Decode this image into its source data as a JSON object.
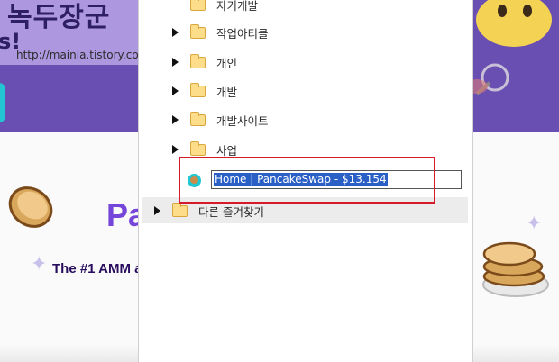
{
  "watermark": {
    "title": "녹두장군",
    "url": "http://mainia.tistory.com",
    "fragment": "s!"
  },
  "background": {
    "heading_fragment": "Pa",
    "tagline_fragment": "The #1 AMM a"
  },
  "bookmarks": {
    "items": [
      {
        "label": "자기개발"
      },
      {
        "label": "작업아티클"
      },
      {
        "label": "개인"
      },
      {
        "label": "개발"
      },
      {
        "label": "개발사이트"
      },
      {
        "label": "사업"
      }
    ],
    "editing_item": {
      "value": "Home | PancakeSwap - $13.154",
      "icon": "pancakeswap-favicon"
    },
    "other_bookmarks": "다른 즐겨찾기"
  },
  "colors": {
    "header_purple": "#6a4fb3",
    "accent_purple": "#7645d9",
    "selection_blue": "#2a5fc6",
    "annotation_red": "#d51b2a"
  }
}
